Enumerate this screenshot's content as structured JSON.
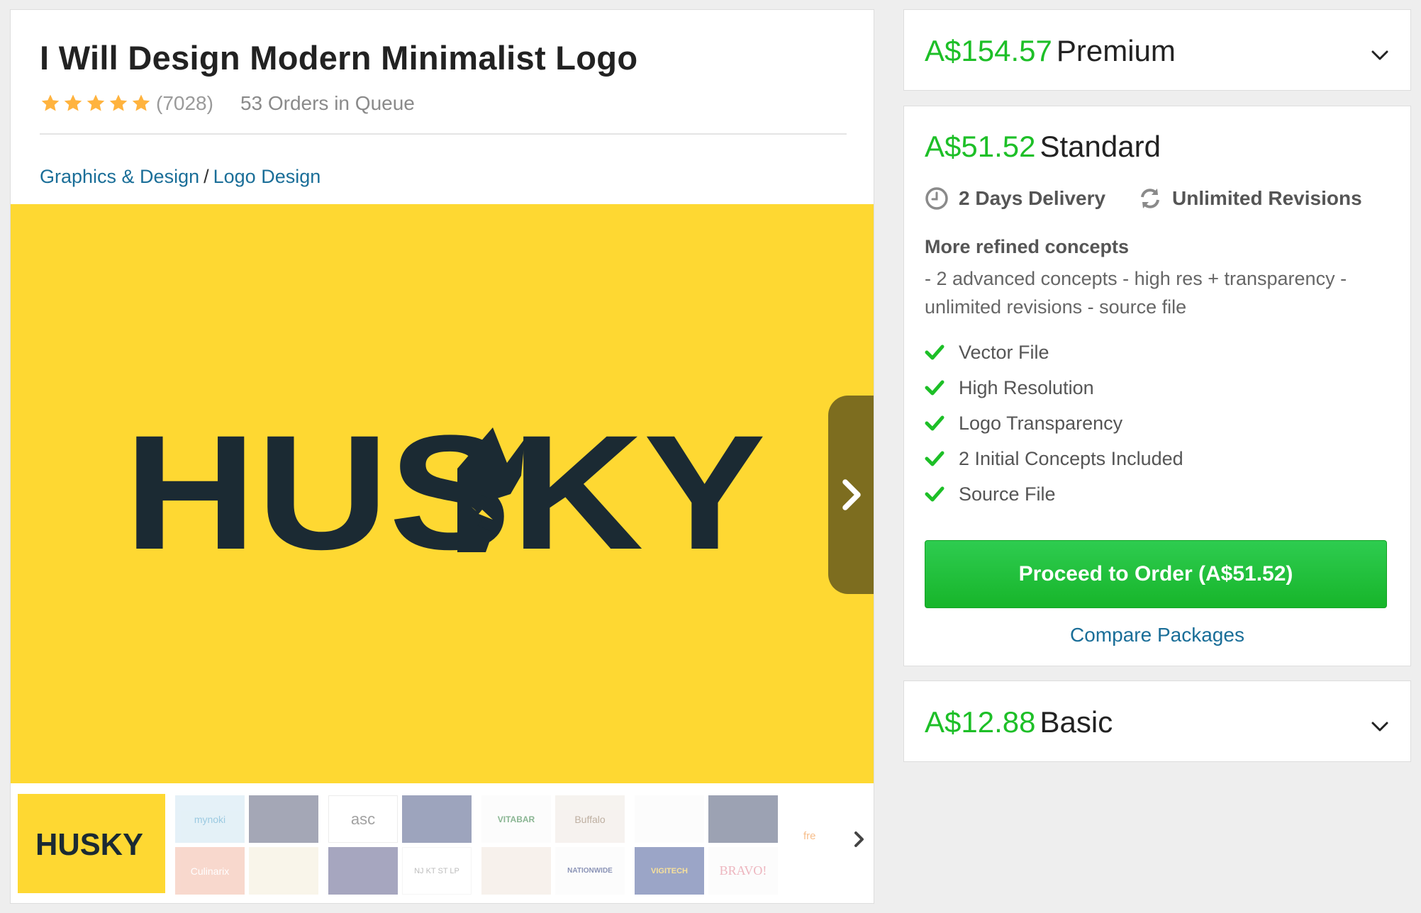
{
  "gig": {
    "title": "I Will Design Modern Minimalist Logo",
    "rating_stars": 5,
    "rating_count": "(7028)",
    "queue": "53 Orders in Queue"
  },
  "breadcrumb": {
    "category": "Graphics & Design",
    "separator": "/",
    "subcategory": "Logo Design"
  },
  "gallery": {
    "hero_text": "HUSKY",
    "thumb_text": "HUSKY",
    "thumbnail_labels": [
      "mynoki",
      "",
      "Culinarix",
      "",
      "asc",
      "",
      "",
      "NJ KT ST LP",
      "VITABAR",
      "Buffalo",
      "",
      "NATIONWIDE",
      "",
      "",
      "VIGITECH",
      "BRAVO!"
    ],
    "faded_label": "fre"
  },
  "packages": {
    "premium": {
      "price": "A$154.57",
      "name": "Premium"
    },
    "standard": {
      "price": "A$51.52",
      "name": "Standard",
      "delivery": "2 Days Delivery",
      "revisions": "Unlimited Revisions",
      "concept_title": "More refined concepts",
      "concept_desc": "- 2 advanced concepts - high res + transparency - unlimited revisions - source file",
      "features": [
        "Vector File",
        "High Resolution",
        "Logo Transparency",
        "2 Initial Concepts Included",
        "Source File"
      ],
      "order_button": "Proceed to Order (A$51.52)",
      "compare_link": "Compare Packages"
    },
    "basic": {
      "price": "A$12.88",
      "name": "Basic"
    }
  },
  "colors": {
    "accent_green": "#1dbf27",
    "link_blue": "#1a6e98",
    "hero_yellow": "#fed832",
    "star_gold": "#ffb33e",
    "logo_navy": "#1b2a33"
  },
  "icons": [
    "star-icon",
    "clock-icon",
    "refresh-icon",
    "check-icon",
    "chevron-down-icon",
    "chevron-right-icon"
  ]
}
